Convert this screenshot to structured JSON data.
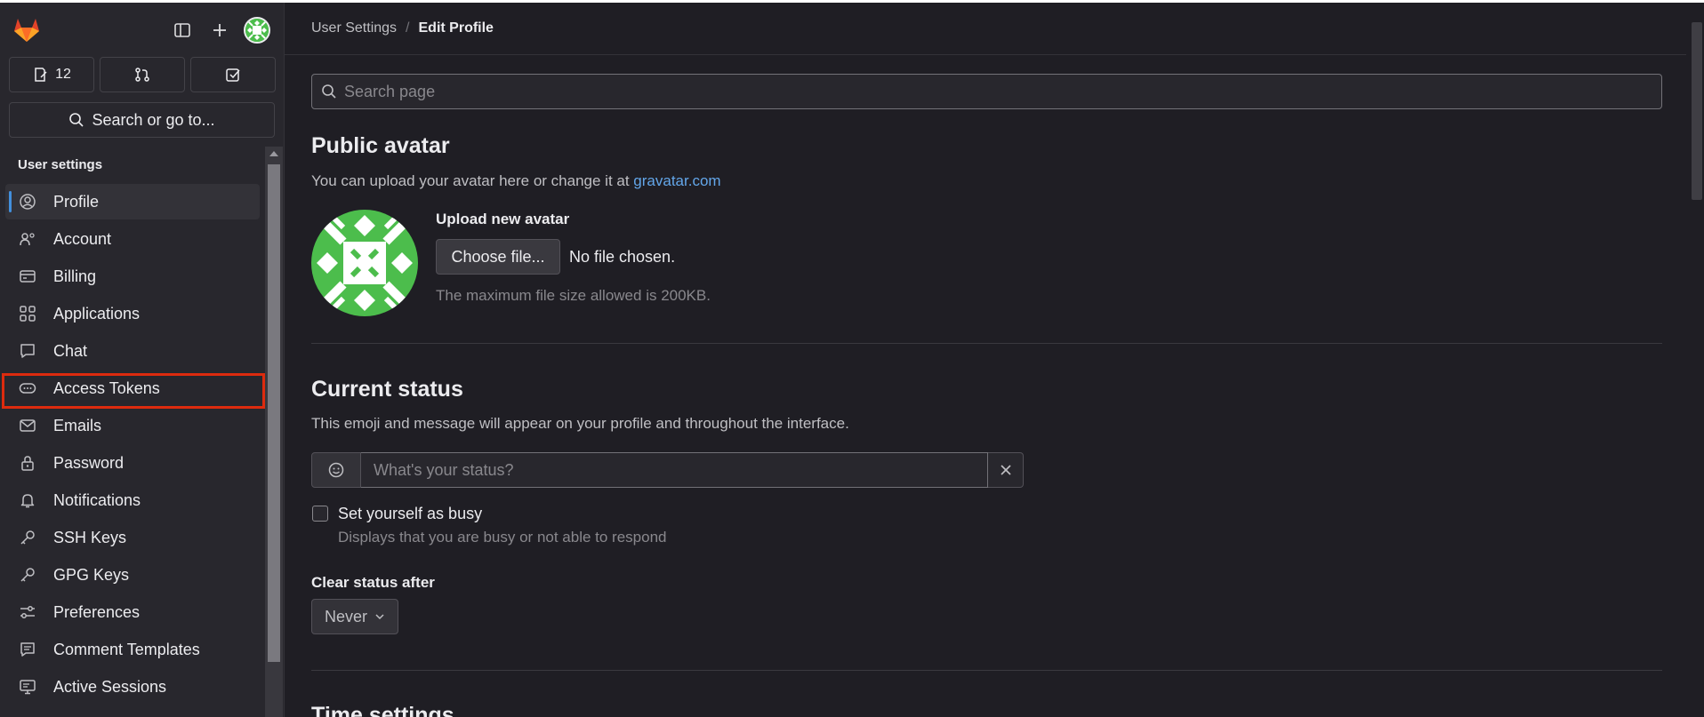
{
  "sidebar": {
    "counts": {
      "issues": "12"
    },
    "search_label": "Search or go to...",
    "section_title": "User settings",
    "items": [
      {
        "label": "Profile",
        "icon": "profile-icon"
      },
      {
        "label": "Account",
        "icon": "account-icon"
      },
      {
        "label": "Billing",
        "icon": "billing-icon"
      },
      {
        "label": "Applications",
        "icon": "applications-icon"
      },
      {
        "label": "Chat",
        "icon": "chat-icon"
      },
      {
        "label": "Access Tokens",
        "icon": "token-icon"
      },
      {
        "label": "Emails",
        "icon": "mail-icon"
      },
      {
        "label": "Password",
        "icon": "lock-icon"
      },
      {
        "label": "Notifications",
        "icon": "bell-icon"
      },
      {
        "label": "SSH Keys",
        "icon": "key-icon"
      },
      {
        "label": "GPG Keys",
        "icon": "key-icon"
      },
      {
        "label": "Preferences",
        "icon": "preferences-icon"
      },
      {
        "label": "Comment Templates",
        "icon": "comment-icon"
      },
      {
        "label": "Active Sessions",
        "icon": "monitor-icon"
      }
    ]
  },
  "breadcrumb": {
    "parent": "User Settings",
    "separator": "/",
    "current": "Edit Profile"
  },
  "search": {
    "placeholder": "Search page"
  },
  "avatar_section": {
    "title": "Public avatar",
    "description": "You can upload your avatar here or change it at ",
    "link": "gravatar.com",
    "upload_label": "Upload new avatar",
    "choose_button": "Choose file...",
    "no_file": "No file chosen.",
    "max_size": "The maximum file size allowed is 200KB."
  },
  "status_section": {
    "title": "Current status",
    "description": "This emoji and message will appear on your profile and throughout the interface.",
    "status_placeholder": "What's your status?",
    "busy_label": "Set yourself as busy",
    "busy_help": "Displays that you are busy or not able to respond",
    "clear_label": "Clear status after",
    "clear_value": "Never"
  },
  "time_section": {
    "title": "Time settings"
  },
  "colors": {
    "accent": "#428fdc",
    "link": "#63a6e9",
    "highlight": "#dd2b0e",
    "avatar_green": "#4cbd4c"
  }
}
